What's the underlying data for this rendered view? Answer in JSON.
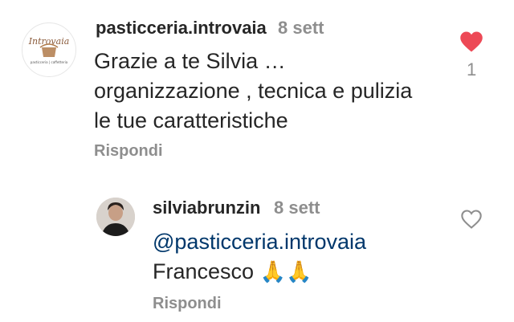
{
  "comments": [
    {
      "username": "pasticceria.introvaia",
      "time": "8 sett",
      "lines": [
        "Grazie a te Silvia …",
        "organizzazione , tecnica e pulizia",
        "le tue caratteristiche"
      ],
      "reply_label": "Rispondi",
      "likes": "1",
      "liked": true,
      "avatar_logo": "Introvaia",
      "avatar_sub": "pasticceria | caffetteria"
    },
    {
      "username": "silviabrunzin",
      "time": "8 sett",
      "mention": "@pasticceria.introvaia",
      "text": "Francesco",
      "emojis": "🙏🙏",
      "reply_label": "Rispondi",
      "liked": false
    }
  ],
  "colors": {
    "heart_filled": "#ed4956",
    "secondary": "#8e8e8e",
    "mention": "#00376b"
  },
  "icons": {
    "liked": "heart-filled-icon",
    "unliked": "heart-outline-icon"
  }
}
